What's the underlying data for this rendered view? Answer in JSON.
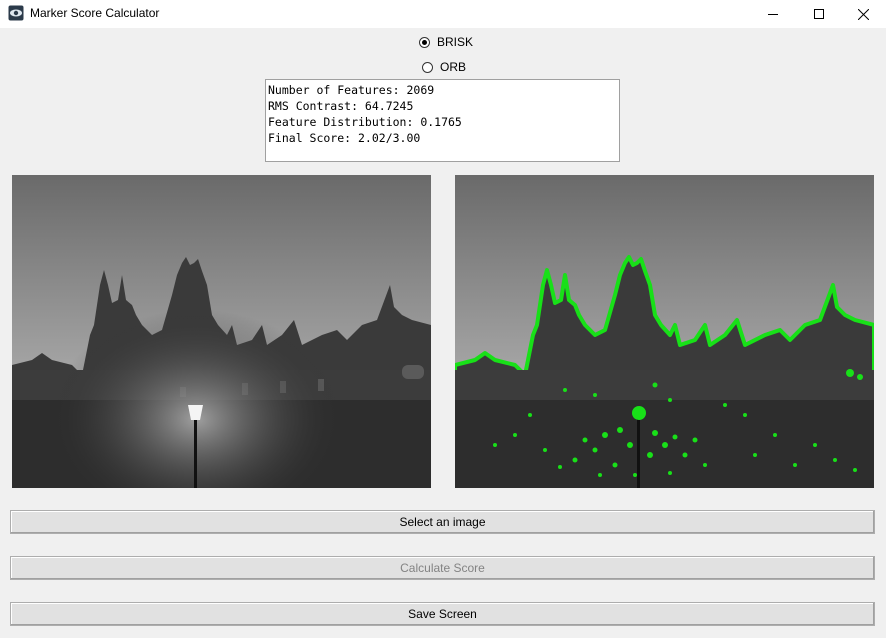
{
  "window": {
    "title": "Marker Score Calculator",
    "icon": "app-icon",
    "controls": [
      "minimize-icon",
      "maximize-icon",
      "close-icon"
    ]
  },
  "detector_options": [
    {
      "label": "BRISK",
      "checked": true
    },
    {
      "label": "ORB",
      "checked": false
    }
  ],
  "results": {
    "lines": [
      "Number of Features: 2069",
      "RMS Contrast: 64.7245",
      "Feature Distribution: 0.1765",
      "Final Score: 2.02/3.00"
    ]
  },
  "images": {
    "original": "grayscale photo of gothic spires behind a stone wall with a street lamp",
    "keypoints": "same photo with detected keypoints drawn in green",
    "keypoint_color": "#18e018"
  },
  "buttons": {
    "select_image": "Select an image",
    "calculate_score": "Calculate Score",
    "save_screen": "Save Screen"
  }
}
